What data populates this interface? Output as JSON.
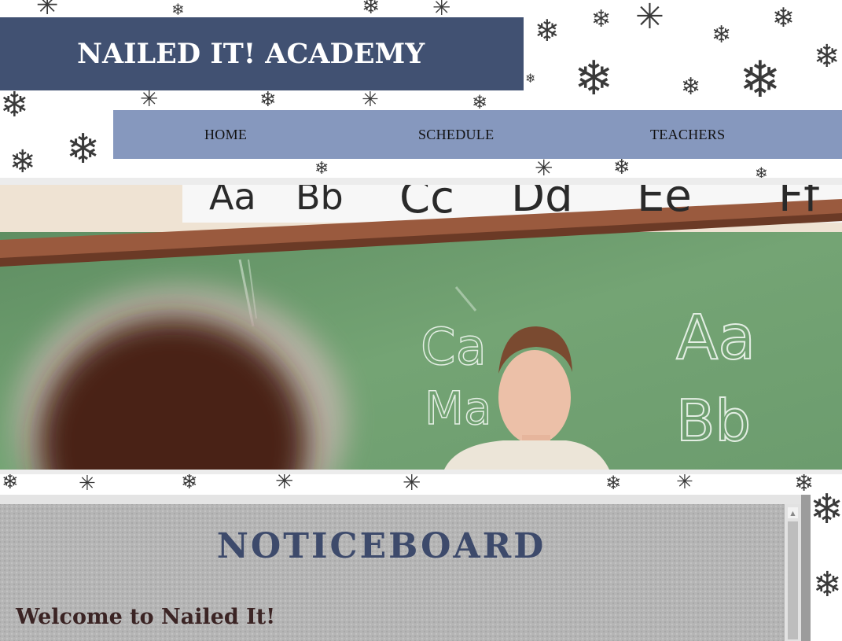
{
  "site": {
    "title": "NAILED IT! ACADEMY"
  },
  "nav": {
    "items": [
      {
        "label": "HOME"
      },
      {
        "label": "SCHEDULE"
      },
      {
        "label": "TEACHERS"
      }
    ]
  },
  "hero": {
    "board_letters_top": [
      "Aa",
      "Bb",
      "Cc",
      "Dd",
      "Ee",
      "Ff"
    ],
    "board_writing": [
      "Ca",
      "Ma",
      "Aa",
      "Bb"
    ]
  },
  "noticeboard": {
    "heading": "NOTICEBOARD",
    "welcome": "Welcome to Nailed It!"
  },
  "colors": {
    "banner": "#415172",
    "nav": "#8698be",
    "heading": "#3d4a6b",
    "chalkboard": "#6f9c6f"
  },
  "icons": {
    "background": "snowflake-icon",
    "scroll_up": "arrow-up-icon"
  }
}
